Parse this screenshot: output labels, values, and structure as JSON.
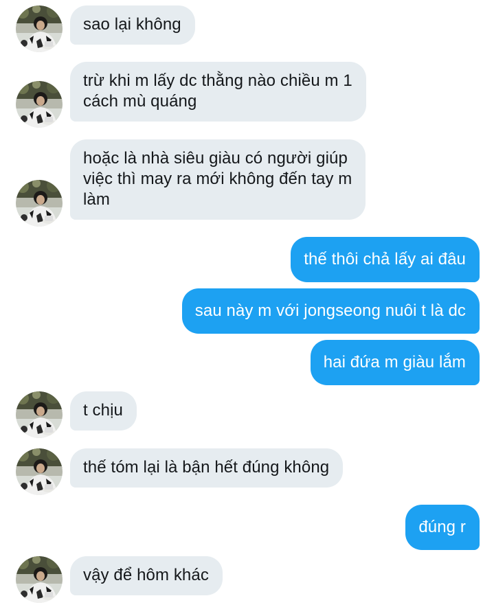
{
  "messages": [
    {
      "id": "m1",
      "side": "incoming",
      "text": "sao lại không"
    },
    {
      "id": "m2",
      "side": "incoming",
      "text": "trừ khi m lấy dc thằng nào chiều m 1\ncách mù quáng"
    },
    {
      "id": "m3",
      "side": "incoming",
      "text": "hoặc là nhà siêu giàu có người giúp\nviệc thì may ra mới không đến tay m\nlàm"
    },
    {
      "id": "m4",
      "side": "outgoing",
      "text": "thế thôi chả lấy ai đâu"
    },
    {
      "id": "m5",
      "side": "outgoing",
      "text": "sau này m với jongseong nuôi t là dc"
    },
    {
      "id": "m6",
      "side": "outgoing",
      "text": "hai đứa m giàu lắm"
    },
    {
      "id": "m7",
      "side": "incoming",
      "text": "t chịu"
    },
    {
      "id": "m8",
      "side": "incoming",
      "text": "thế tóm lại là bận hết đúng không"
    },
    {
      "id": "m9",
      "side": "outgoing",
      "text": "đúng r"
    },
    {
      "id": "m10",
      "side": "incoming",
      "text": "vậy để hôm khác"
    }
  ],
  "colors": {
    "incoming_bubble": "#e6ecf0",
    "incoming_text": "#14171a",
    "outgoing_bubble": "#1da1f2",
    "outgoing_text": "#ffffff",
    "background": "#ffffff"
  },
  "avatar": {
    "icon": "user-photo-avatar"
  }
}
